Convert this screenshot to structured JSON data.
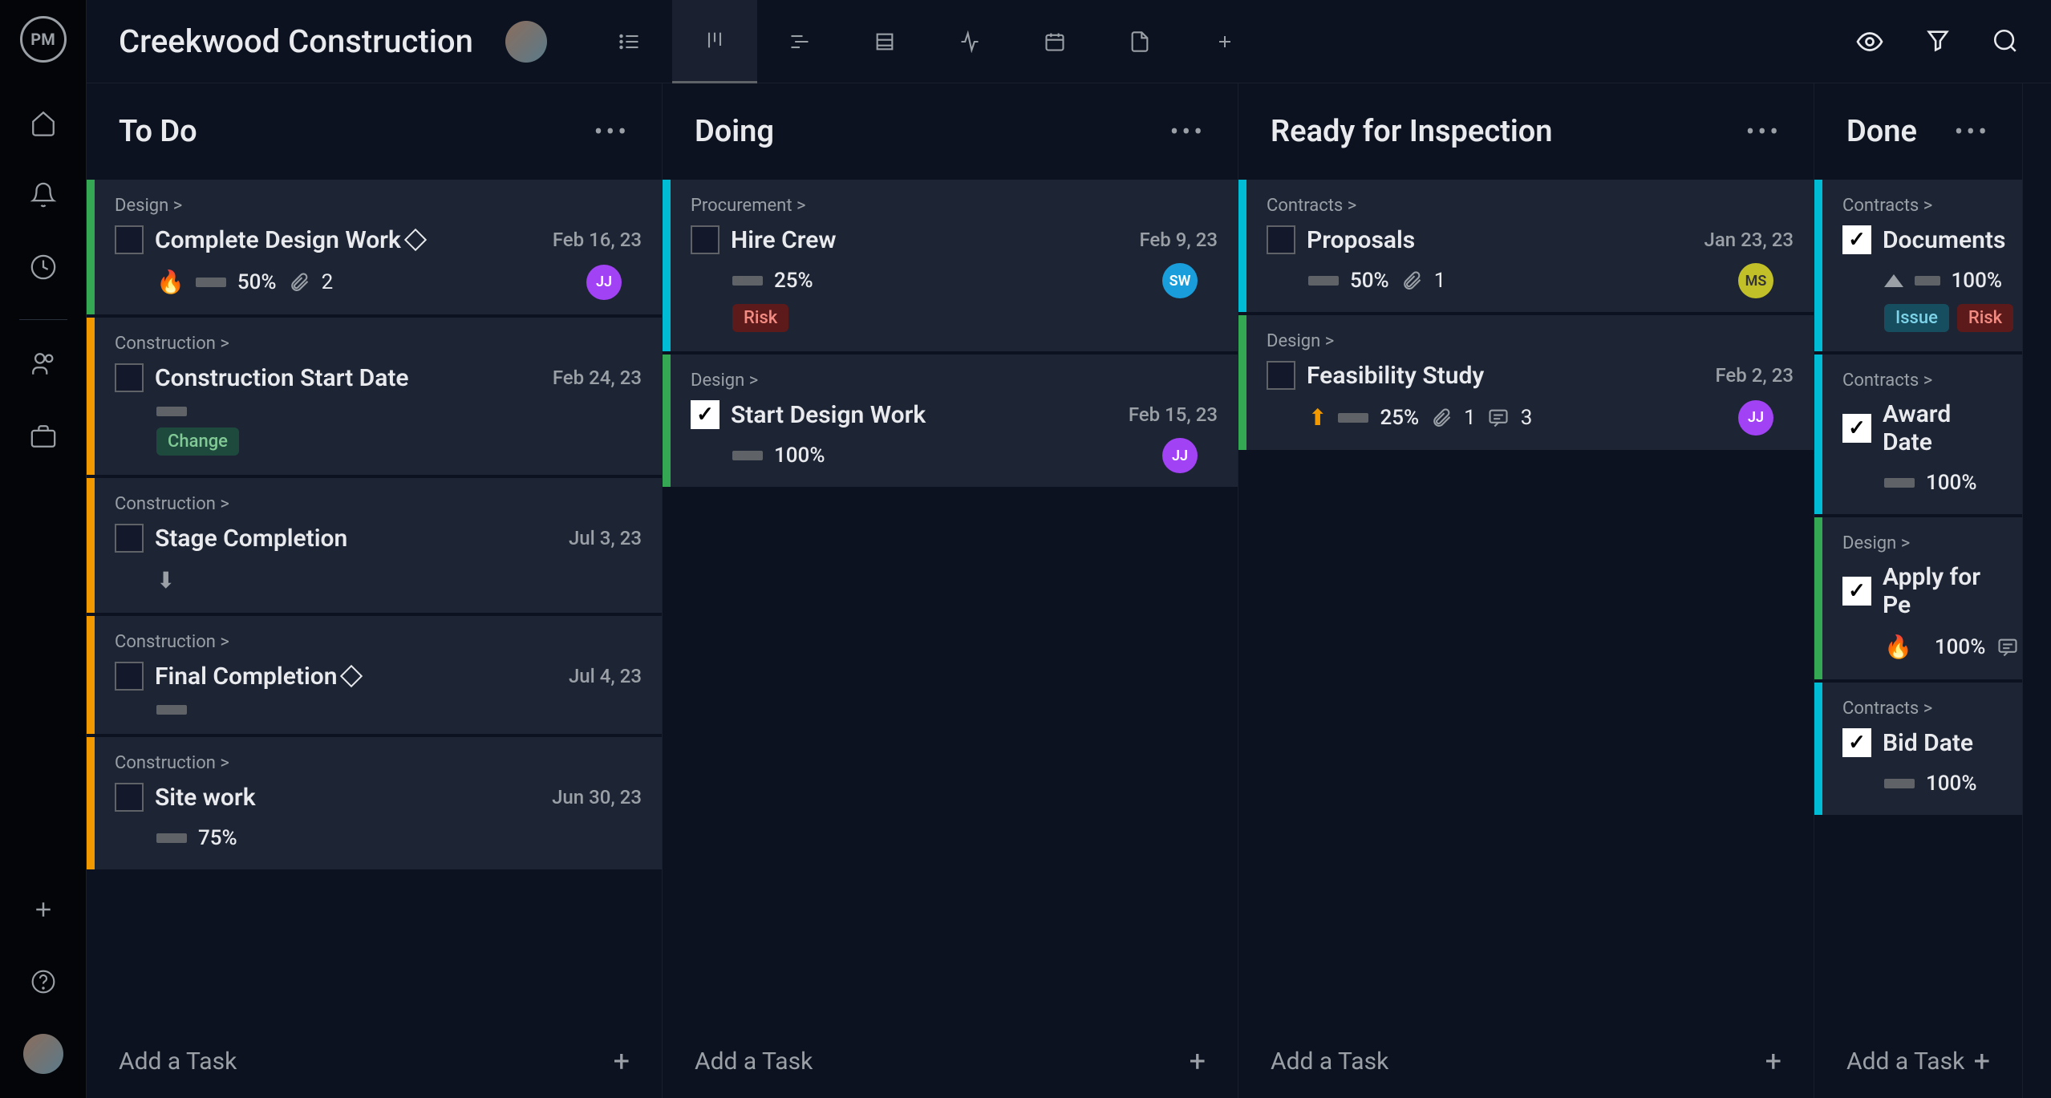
{
  "logo": "PM",
  "project_title": "Creekwood Construction",
  "columns": [
    {
      "title": "To Do",
      "cards": [
        {
          "stripe": "green",
          "breadcrumb": "Design >",
          "title": "Complete Design Work",
          "diamond": true,
          "date": "Feb 16, 23",
          "checked": false,
          "priority": "fire",
          "percent": "50%",
          "attachments": "2",
          "avatar": {
            "initials": "JJ",
            "color": "purple"
          }
        },
        {
          "stripe": "orange",
          "breadcrumb": "Construction >",
          "title": "Construction Start Date",
          "date": "Feb 24, 23",
          "checked": false,
          "barOnly": true,
          "tags": [
            {
              "label": "Change",
              "type": "change"
            }
          ]
        },
        {
          "stripe": "orange",
          "breadcrumb": "Construction >",
          "title": "Stage Completion",
          "date": "Jul 3, 23",
          "checked": false,
          "priority": "down"
        },
        {
          "stripe": "orange",
          "breadcrumb": "Construction >",
          "title": "Final Completion",
          "diamond": true,
          "date": "Jul 4, 23",
          "checked": false,
          "barOnly": true
        },
        {
          "stripe": "orange",
          "breadcrumb": "Construction >",
          "title": "Site work",
          "date": "Jun 30, 23",
          "checked": false,
          "percent": "75%",
          "barOnly": false
        }
      ],
      "add_label": "Add a Task"
    },
    {
      "title": "Doing",
      "cards": [
        {
          "stripe": "blue",
          "breadcrumb": "Procurement >",
          "title": "Hire Crew",
          "date": "Feb 9, 23",
          "checked": false,
          "percent": "25%",
          "avatar": {
            "initials": "SW",
            "color": "blue"
          },
          "tags": [
            {
              "label": "Risk",
              "type": "risk"
            }
          ]
        },
        {
          "stripe": "green",
          "breadcrumb": "Design >",
          "title": "Start Design Work",
          "date": "Feb 15, 23",
          "checked": true,
          "percent": "100%",
          "avatar": {
            "initials": "JJ",
            "color": "purple"
          }
        }
      ],
      "add_label": "Add a Task"
    },
    {
      "title": "Ready for Inspection",
      "cards": [
        {
          "stripe": "blue",
          "breadcrumb": "Contracts >",
          "title": "Proposals",
          "date": "Jan 23, 23",
          "checked": false,
          "percent": "50%",
          "attachments": "1",
          "avatar": {
            "initials": "MS",
            "color": "olive"
          }
        },
        {
          "stripe": "green",
          "breadcrumb": "Design >",
          "title": "Feasibility Study",
          "date": "Feb 2, 23",
          "checked": false,
          "priority": "up-orange",
          "percent": "25%",
          "attachments": "1",
          "comments": "3",
          "avatar": {
            "initials": "JJ",
            "color": "purple"
          }
        }
      ],
      "add_label": "Add a Task"
    },
    {
      "title": "Done",
      "cards": [
        {
          "stripe": "blue",
          "breadcrumb": "Contracts >",
          "title": "Documents",
          "checked": true,
          "priority": "up-solid",
          "percent": "100%",
          "tags": [
            {
              "label": "Issue",
              "type": "issue"
            },
            {
              "label": "Risk",
              "type": "risk"
            }
          ]
        },
        {
          "stripe": "blue",
          "breadcrumb": "Contracts >",
          "title": "Award Date",
          "checked": true,
          "percent": "100%"
        },
        {
          "stripe": "green",
          "breadcrumb": "Design >",
          "title": "Apply for Pe",
          "checked": true,
          "priority": "fire",
          "percent": "100%",
          "comments_icon_only": true
        },
        {
          "stripe": "blue",
          "breadcrumb": "Contracts >",
          "title": "Bid Date",
          "checked": true,
          "percent": "100%"
        }
      ],
      "add_label": "Add a Task"
    }
  ]
}
